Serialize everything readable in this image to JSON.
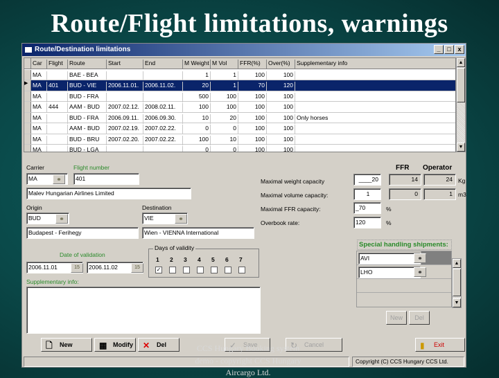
{
  "slide_title": "Route/Flight limitations, warnings",
  "window": {
    "title": "Route/Destination limitations",
    "minimize": "_",
    "maximize": "□",
    "close": "x"
  },
  "grid": {
    "columns": [
      "Car",
      "Flight",
      "Route",
      "Start",
      "End",
      "M Weight",
      "M Vol",
      "FFR(%)",
      "Over(%)",
      "Supplementary info"
    ],
    "rows": [
      [
        "MA",
        "",
        "BAE - BEA",
        "",
        "",
        "1",
        "1",
        "100",
        "100",
        ""
      ],
      [
        "MA",
        "401",
        "BUD - VIE",
        "2006.11.01.",
        "2006.11.02.",
        "20",
        "1",
        "70",
        "120",
        ""
      ],
      [
        "MA",
        "",
        "BUD - FRA",
        "",
        "",
        "500",
        "100",
        "100",
        "100",
        ""
      ],
      [
        "MA",
        "444",
        "AAM - BUD",
        "2007.02.12.",
        "2008.02.11.",
        "100",
        "100",
        "100",
        "100",
        ""
      ],
      [
        "MA",
        "",
        "BUD - FRA",
        "2006.09.11.",
        "2006.09.30.",
        "10",
        "20",
        "100",
        "100",
        "Only horses"
      ],
      [
        "MA",
        "",
        "AAM - BUD",
        "2007.02.19.",
        "2007.02.22.",
        "0",
        "0",
        "100",
        "100",
        ""
      ],
      [
        "MA",
        "",
        "BUD - BRU",
        "2007.02.20.",
        "2007.02.22.",
        "100",
        "10",
        "100",
        "100",
        ""
      ],
      [
        "MA",
        "",
        "BUD - LGA",
        "",
        "",
        "0",
        "0",
        "100",
        "100",
        ""
      ]
    ]
  },
  "form": {
    "carrier_label": "Carrier",
    "carrier": "MA",
    "flight_label": "Flight number",
    "flight": "401",
    "carrier_name": "Malev Hungarian Airlines Limited",
    "origin_label": "Origin",
    "origin": "BUD",
    "origin_name": "Budapest - Ferihegy",
    "dest_label": "Destination",
    "dest": "VIE",
    "dest_name": "Wien - VIENNA International",
    "validation_label": "Date of validation",
    "date_from": "2006.11.01",
    "date_to": "2006.11.02",
    "cal": "15",
    "days_label": "Days of validity",
    "days": [
      "1",
      "2",
      "3",
      "4",
      "5",
      "6",
      "7"
    ],
    "days_checked": [
      true,
      false,
      false,
      false,
      false,
      false,
      false
    ],
    "supp_label": "Supplementary info:",
    "ffr_header": "FFR",
    "operator_header": "Operator",
    "weight_label": "Maximal weight capacity",
    "weight": "____20",
    "weight_ffr": "14",
    "weight_op": "24",
    "weight_unit": "Kg",
    "volume_label": "Maximal volume capacity:",
    "volume": "1",
    "volume_ffr": "0",
    "volume_op": "1",
    "volume_unit": "m3",
    "ffrcap_label": "Maximal FFR capacity:",
    "ffrcap": "_70",
    "pct": "%",
    "overbook_label": "Overbook rate:",
    "overbook": "120",
    "shs_label": "Special handling shipments:",
    "shs": [
      "AVI",
      "LHO"
    ],
    "shs_new": "New",
    "shs_del": "Del"
  },
  "buttons": {
    "new": "New",
    "modify": "Modify",
    "del": "Del",
    "save": "Save",
    "cancel": "Cancel",
    "exit": "Exit"
  },
  "status": {
    "copyright": "Copyright (C) CCS Hungary CCS Ltd."
  },
  "watermark": [
    "CCS Hungary Booking system",
    "demo - copyright CCS Hungary",
    "Aircargo Ltd."
  ]
}
